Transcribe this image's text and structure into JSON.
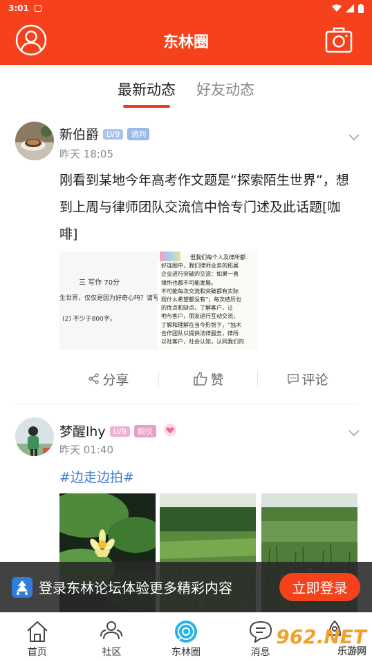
{
  "status_bar": {
    "time": "3:01"
  },
  "app_bar": {
    "title": "东林圈"
  },
  "tabs": [
    {
      "label": "最新动态",
      "active": true
    },
    {
      "label": "好友动态",
      "active": false
    }
  ],
  "posts": [
    {
      "username": "新伯爵",
      "level_badge": "LV9",
      "role_badge": "通判",
      "time": "昨天 18:05",
      "text": "刚看到某地今年高考作文题是“探索陌生世界”，想到上周与律师团队交流信中恰专门述及此话题[咖啡]",
      "image1_lines": [
        "三  写作  70分",
        "生世界，仅仅是因为好奇心吗？请写一",
        "(2) 不少于800字。"
      ],
      "image2_lines": [
        "但我们每个人及律所都",
        "好连圈中，我们律师业务的拓展",
        "企业进行突破的交流：如果一直",
        "律所也都不可能发展。",
        "不可能每次交流和突破都有实际",
        "则什么希望都没有”；每次结历也",
        "的优点和缺点，了解客户，让",
        "地与客户，朋友进行互动交流，",
        "了解和理解在当今形势下，“独木",
        "合作团队以提供法律服务，律所",
        "以社客户，社会认知，认同我们的"
      ],
      "actions": {
        "share": "分享",
        "like": "赞",
        "comment": "评论"
      }
    },
    {
      "username": "梦醒lhy",
      "level_badge": "LV9",
      "role_badge": "婉仪",
      "time": "昨天 01:40",
      "tag": "#边走边拍#"
    }
  ],
  "banner": {
    "text": "登录东林论坛体验更多精彩内容",
    "button": "立即登录"
  },
  "bottom_nav": [
    {
      "label": "首页",
      "icon": "home-icon"
    },
    {
      "label": "社区",
      "icon": "community-icon"
    },
    {
      "label": "东林圈",
      "icon": "circle-icon",
      "active": true
    },
    {
      "label": "消息",
      "icon": "message-icon"
    },
    {
      "label": "",
      "icon": "rocket-icon"
    }
  ],
  "watermark": {
    "main": "962.NET",
    "sub": "乐游网"
  },
  "colors": {
    "brand": "#f5421d",
    "tag": "#3a7bd5"
  }
}
